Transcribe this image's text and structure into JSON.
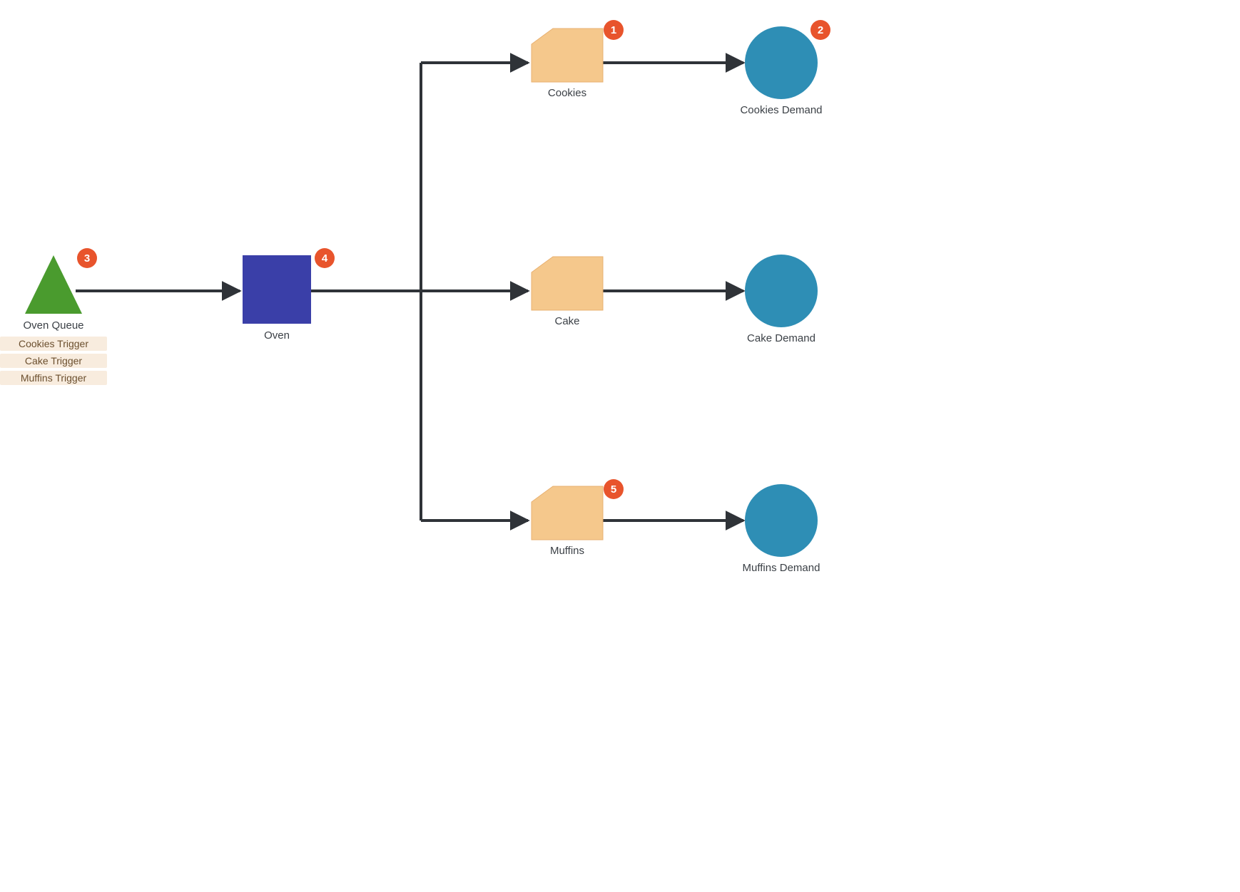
{
  "nodes": {
    "oven_queue": {
      "label": "Oven Queue"
    },
    "oven": {
      "label": "Oven"
    },
    "cookies": {
      "label": "Cookies"
    },
    "cake": {
      "label": "Cake"
    },
    "muffins": {
      "label": "Muffins"
    },
    "cookies_demand": {
      "label": "Cookies Demand"
    },
    "cake_demand": {
      "label": "Cake Demand"
    },
    "muffins_demand": {
      "label": "Muffins Demand"
    }
  },
  "triggers": {
    "t1": "Cookies Trigger",
    "t2": "Cake Trigger",
    "t3": "Muffins Trigger"
  },
  "badges": {
    "b1": "1",
    "b2": "2",
    "b3": "3",
    "b4": "4",
    "b5": "5"
  },
  "colors": {
    "queue": "#4a9b2e",
    "process": "#3a3fa8",
    "store": "#f5c88c",
    "store_stroke": "#e8b070",
    "demand": "#2e8eb5",
    "arrow": "#2f3338",
    "badge": "#e8542c"
  }
}
